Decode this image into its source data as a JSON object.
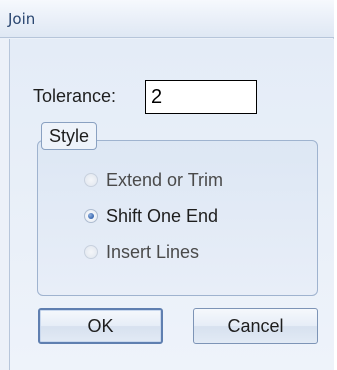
{
  "window": {
    "title": "Join"
  },
  "tolerance": {
    "label": "Tolerance:",
    "value": "2"
  },
  "style_group": {
    "legend": "Style",
    "options": [
      {
        "label": "Extend or Trim",
        "selected": false,
        "enabled": false
      },
      {
        "label": "Shift One End",
        "selected": true,
        "enabled": true
      },
      {
        "label": "Insert Lines",
        "selected": false,
        "enabled": false
      }
    ]
  },
  "buttons": {
    "ok_label": "OK",
    "cancel_label": "Cancel"
  },
  "colors": {
    "title_text": "#2a4670",
    "dialog_bg": "#ecf1f9",
    "radio_dot": "#2f5ea8"
  }
}
